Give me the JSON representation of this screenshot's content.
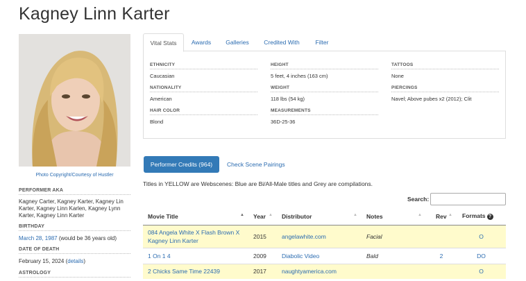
{
  "page": {
    "title": "Kagney Linn Karter"
  },
  "sidebar": {
    "photo_credit": "Photo Copyright/Courtesy of Hustler",
    "aka_label": "PERFORMER AKA",
    "aka_value": "Kagney Carter, Kagney Karter, Kagney Lin Karter, Kagney Linn Karlen, Kagney Lynn Karter, Kagney Linn Karter",
    "birthday_label": "BIRTHDAY",
    "birthday_date": "March 28, 1987",
    "birthday_note": "(would be 36 years old)",
    "death_label": "DATE OF DEATH",
    "death_date": "February 15, 2024",
    "death_paren_open": "(",
    "death_details": "details",
    "death_paren_close": ")",
    "astrology_label": "ASTROLOGY"
  },
  "tabs": {
    "vital": "Vital Stats",
    "awards": "Awards",
    "galleries": "Galleries",
    "credited": "Credited With",
    "filter": "Filter"
  },
  "stats": {
    "ethnicity_label": "ETHNICITY",
    "ethnicity": "Caucasian",
    "nationality_label": "NATIONALITY",
    "nationality": "American",
    "hair_label": "HAIR COLOR",
    "hair": "Blond",
    "height_label": "HEIGHT",
    "height": "5 feet, 4 inches (163 cm)",
    "weight_label": "WEIGHT",
    "weight": "118 lbs (54 kg)",
    "measurements_label": "MEASUREMENTS",
    "measurements": "36D-25-36",
    "tattoos_label": "TATTOOS",
    "tattoos": "None",
    "piercings_label": "PIERCINGS",
    "piercings": "Navel; Above pubes x2 (2012); Clit"
  },
  "credits": {
    "button": "Performer Credits (964)",
    "scene_pairings": "Check Scene Pairings",
    "legend": "Titles in YELLOW are Webscenes: Blue are Bi/All-Male titles and Grey are compilations.",
    "search_label": "Search:",
    "search_value": "",
    "columns": {
      "title": "Movie Title",
      "year": "Year",
      "distributor": "Distributor",
      "notes": "Notes",
      "rev": "Rev",
      "formats": "Formats"
    },
    "rows": [
      {
        "title": "084 Angela White X Flash Brown X Kagney Linn Karter",
        "year": "2015",
        "distributor": "angelawhite.com",
        "notes": "Facial",
        "rev": "",
        "formats": "O"
      },
      {
        "title": "1 On 1 4",
        "year": "2009",
        "distributor": "Diabolic Video",
        "notes": "Bald",
        "rev": "2",
        "formats": "DO"
      },
      {
        "title": "2 Chicks Same Time 22439",
        "year": "2017",
        "distributor": "naughtyamerica.com",
        "notes": "",
        "rev": "",
        "formats": "O"
      }
    ]
  },
  "colors": {
    "link": "#2a6bb0",
    "button": "#337ab7",
    "webscene_row": "#fffbcc"
  }
}
